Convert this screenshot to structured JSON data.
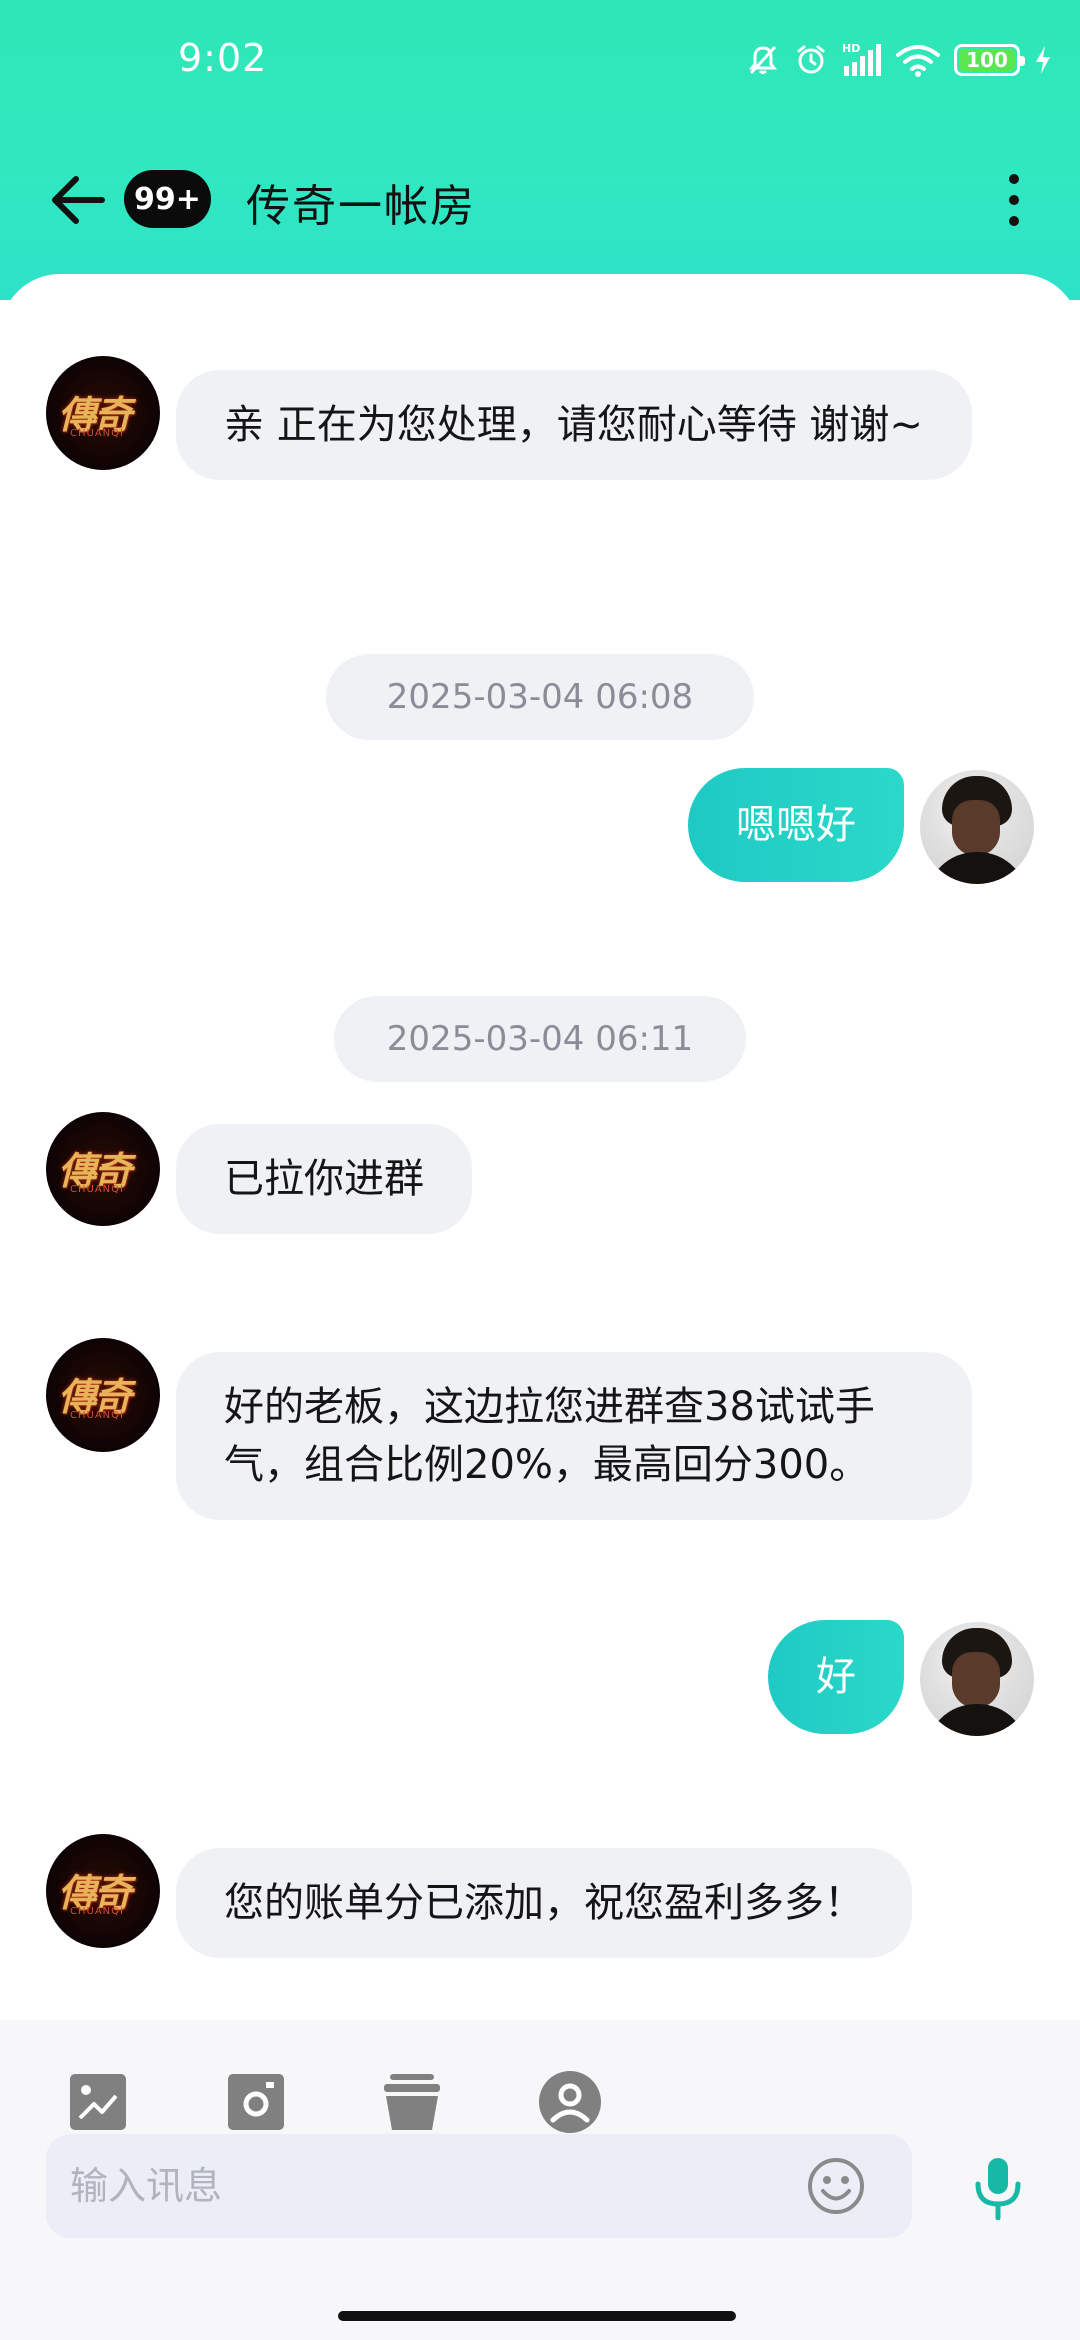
{
  "status_bar": {
    "time": "9:02",
    "battery": "100",
    "signal_label": "HD"
  },
  "header": {
    "unread_count": "99+",
    "title": "传奇一帐房"
  },
  "messages": [
    {
      "side": "left",
      "text": "亲   正在为您处理，请您耐心等待 谢谢~"
    },
    {
      "type": "timestamp",
      "text": "2025-03-04 06:08"
    },
    {
      "side": "right",
      "text": "嗯嗯好"
    },
    {
      "type": "timestamp",
      "text": "2025-03-04 06:11"
    },
    {
      "side": "left",
      "text": "已拉你进群"
    },
    {
      "side": "left",
      "text": "好的老板，这边拉您进群查38试试手气，组合比例20%，最高回分300。"
    },
    {
      "side": "right",
      "text": "好"
    },
    {
      "side": "left",
      "text": "您的账单分已添加，祝您盈利多多！"
    }
  ],
  "avatar_logo": {
    "text": "傳奇",
    "sub": "CHUANQI"
  },
  "composer": {
    "placeholder": "输入讯息"
  },
  "colors": {
    "header_gradient_top": "#2fe6b6",
    "header_gradient_bottom": "#2ee2c8",
    "outgoing_bubble": "#1fc9c4",
    "incoming_bubble": "#f0f1f5",
    "mic_accent": "#17b8a6"
  },
  "icons": {
    "back": "arrow-left-icon",
    "more": "more-vertical-icon",
    "image": "image-icon",
    "camera": "camera-icon",
    "trash": "trash-icon",
    "contact": "contact-icon",
    "emoji": "emoji-icon",
    "mic": "microphone-icon"
  }
}
